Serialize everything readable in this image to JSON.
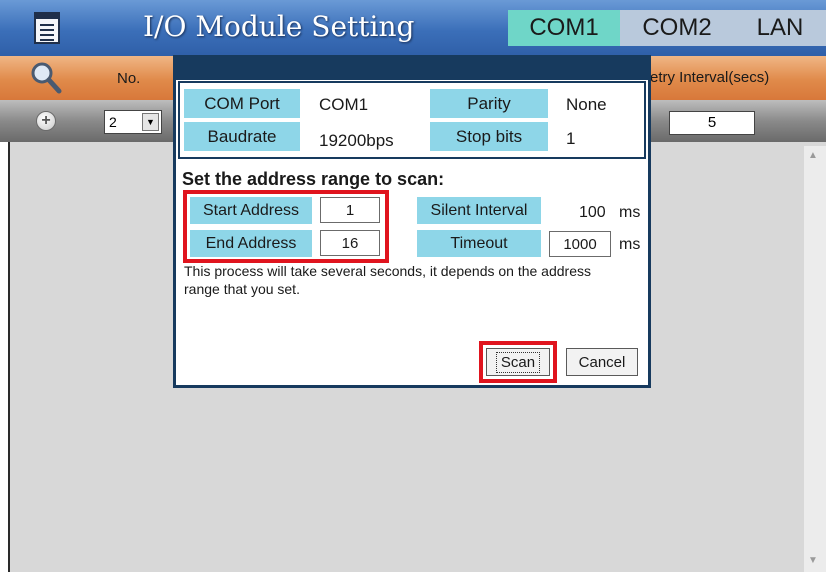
{
  "header": {
    "title": "I/O Module Setting",
    "tabs": [
      {
        "label": "COM1",
        "active": true
      },
      {
        "label": "COM2",
        "active": false
      },
      {
        "label": "LAN",
        "active": false
      }
    ]
  },
  "columns": {
    "no_label": "No.",
    "retry_label": "etry Interval(secs)"
  },
  "row": {
    "no_value": "2",
    "retry_value": "5"
  },
  "dialog": {
    "com_port_label": "COM Port",
    "com_port_value": "COM1",
    "parity_label": "Parity",
    "parity_value": "None",
    "baudrate_label": "Baudrate",
    "baudrate_value": "19200bps",
    "stop_bits_label": "Stop bits",
    "stop_bits_value": "1",
    "scan_heading": "Set the address range to scan:",
    "start_address_label": "Start Address",
    "start_address_value": "1",
    "end_address_label": "End Address",
    "end_address_value": "16",
    "silent_interval_label": "Silent Interval",
    "silent_interval_value": "100",
    "silent_interval_unit": "ms",
    "timeout_label": "Timeout",
    "timeout_value": "1000",
    "timeout_unit": "ms",
    "note": "This process will take several seconds, it depends on the address range that you set.",
    "scan_button": "Scan",
    "cancel_button": "Cancel"
  },
  "colors": {
    "title_bar": "#3b6fb9",
    "active_tab": "#6fd6c8",
    "inactive_tab": "#b9c9dc",
    "column_header": "#e08a4a",
    "label_cell": "#8ed6e8",
    "dialog_frame": "#173a5e",
    "highlight": "#e0141e"
  }
}
